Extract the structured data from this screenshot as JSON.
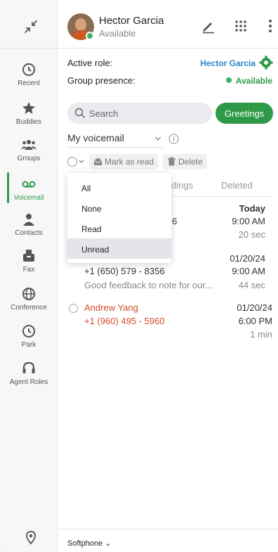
{
  "user": {
    "name": "Hector Garcia",
    "status": "Available"
  },
  "nav": [
    {
      "label": "Recent",
      "icon": "clock-icon"
    },
    {
      "label": "Buddies",
      "icon": "star-icon"
    },
    {
      "label": "Groups",
      "icon": "group-icon"
    },
    {
      "label": "Voicemail",
      "icon": "voicemail-icon",
      "active": true
    },
    {
      "label": "Contacts",
      "icon": "contact-icon"
    },
    {
      "label": "Fax",
      "icon": "fax-icon"
    },
    {
      "label": "Conference",
      "icon": "globe-icon"
    },
    {
      "label": "Park",
      "icon": "clock-icon"
    },
    {
      "label": "Agent Roles",
      "icon": "headset-icon"
    }
  ],
  "role": {
    "label": "Active role:",
    "value": "Hector Garcia"
  },
  "presence": {
    "label": "Group presence:",
    "value": "Available"
  },
  "search": {
    "placeholder": "Search"
  },
  "greetings_label": "Greetings",
  "voicemail_select": "My voicemail",
  "actions": {
    "mark_read": "Mark as read",
    "delete": "Delete"
  },
  "tabs": {
    "recordings_partial": "dings",
    "deleted": "Deleted"
  },
  "dropdown": [
    "All",
    "None",
    "Read",
    "Unread"
  ],
  "messages": [
    {
      "number_partial": "6",
      "date": "Today",
      "time": "9:00 AM",
      "duration": "20 sec"
    },
    {
      "number": "+1 (650) 579 - 8356",
      "preview": "Good feedback to note for our...",
      "date": "01/20/24",
      "time": "9:00 AM",
      "duration": "44 sec"
    },
    {
      "name": "Andrew Yang",
      "number": "+1 (960) 495 - 5960",
      "date": "01/20/24",
      "time": "6:00 PM",
      "duration": "1 min"
    }
  ],
  "footer": {
    "softphone": "Softphone"
  },
  "colors": {
    "accent_green": "#2e9a47",
    "link_blue": "#2a86c9",
    "missed_red": "#d54d2c"
  }
}
